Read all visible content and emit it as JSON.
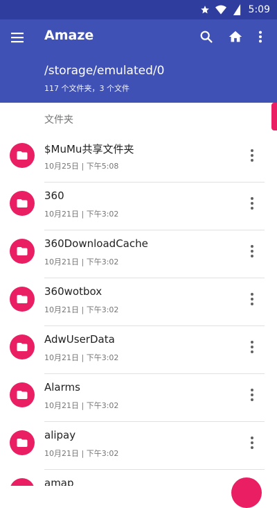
{
  "status_bar": {
    "time": "5:09",
    "icons": [
      "star-icon",
      "wifi-icon",
      "battery-icon"
    ]
  },
  "app_bar": {
    "title": "Amaze",
    "path": "/storage/emulated/0",
    "summary": "117 个文件夹，3 个文件",
    "actions": [
      "search-icon",
      "home-icon",
      "more-vert-icon"
    ],
    "color": "#3f51b5",
    "status_color": "#2f3e9e"
  },
  "list": {
    "section_header": "文件夹",
    "accent": "#e91e63",
    "items": [
      {
        "name": "$MuMu共享文件夹",
        "meta": "10月25日 | 下午5:08"
      },
      {
        "name": "360",
        "meta": "10月21日 | 下午3:02"
      },
      {
        "name": "360DownloadCache",
        "meta": "10月21日 | 下午3:02"
      },
      {
        "name": "360wotbox",
        "meta": "10月21日 | 下午3:02"
      },
      {
        "name": "AdwUserData",
        "meta": "10月21日 | 下午3:02"
      },
      {
        "name": "Alarms",
        "meta": "10月21日 | 下午3:02"
      },
      {
        "name": "alipay",
        "meta": "10月21日 | 下午3:02"
      },
      {
        "name": "amap",
        "meta": ""
      }
    ]
  }
}
